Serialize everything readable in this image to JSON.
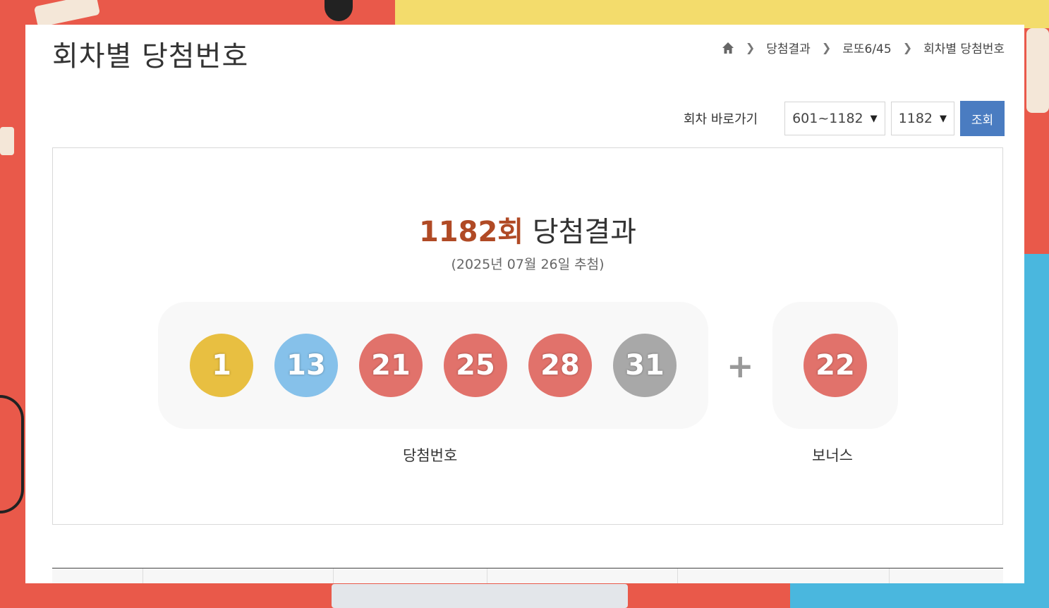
{
  "page": {
    "title": "회차별 당첨번호"
  },
  "breadcrumb": {
    "home_icon": "home-icon",
    "items": [
      "당첨결과",
      "로또6/45",
      "회차별 당첨번호"
    ]
  },
  "round_jump": {
    "label": "회차 바로가기",
    "range_select": "601~1182",
    "round_select": "1182",
    "search_button": "조회"
  },
  "result": {
    "round": "1182회",
    "title_suffix": "당첨결과",
    "draw_date": "(2025년 07월 26일 추첨)",
    "winning_numbers": [
      {
        "value": "1",
        "color": "#e8bf41"
      },
      {
        "value": "13",
        "color": "#86c1ea"
      },
      {
        "value": "21",
        "color": "#e1726b"
      },
      {
        "value": "25",
        "color": "#e1726b"
      },
      {
        "value": "28",
        "color": "#e1726b"
      },
      {
        "value": "31",
        "color": "#a8a8a8"
      }
    ],
    "plus_sign": "+",
    "bonus_number": {
      "value": "22",
      "color": "#e1726b"
    },
    "winning_caption": "당첨번호",
    "bonus_caption": "보너스"
  },
  "colors": {
    "accent_round": "#b04a25",
    "button_blue": "#4a7cc1"
  }
}
